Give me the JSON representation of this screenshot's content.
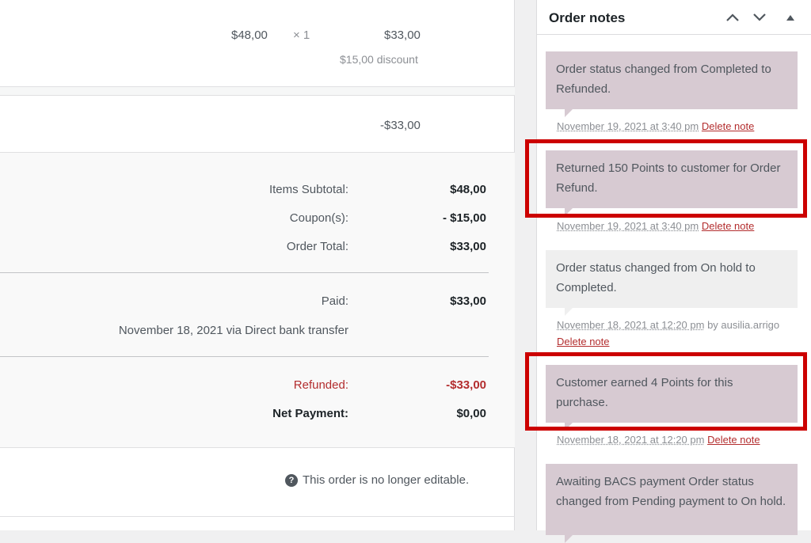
{
  "line_item": {
    "cost": "$48,00",
    "qty": "× 1",
    "total": "$33,00",
    "discount": "$15,00 discount"
  },
  "refund_line": {
    "amount": "-$33,00"
  },
  "totals": {
    "items_subtotal_label": "Items Subtotal:",
    "items_subtotal_value": "$48,00",
    "coupons_label": "Coupon(s):",
    "coupons_value": "- $15,00",
    "order_total_label": "Order Total:",
    "order_total_value": "$33,00"
  },
  "payment": {
    "paid_label": "Paid:",
    "paid_value": "$33,00",
    "paid_detail": "November 18, 2021 via Direct bank transfer"
  },
  "refund": {
    "refunded_label": "Refunded:",
    "refunded_value": "-$33,00",
    "net_label": "Net Payment:",
    "net_value": "$0,00"
  },
  "footer": {
    "not_editable": "This order is no longer editable."
  },
  "notes_panel": {
    "title": "Order notes",
    "notes": [
      {
        "text": "Order status changed from Completed to Refunded.",
        "timestamp": "November 19, 2021 at 3:40 pm",
        "author": "",
        "delete": "Delete note"
      },
      {
        "text": "Returned 150 Points to customer for Order Refund.",
        "timestamp": "November 19, 2021 at 3:40 pm",
        "author": "",
        "delete": "Delete note"
      },
      {
        "text": "Order status changed from On hold to Completed.",
        "timestamp": "November 18, 2021 at 12:20 pm",
        "author": "by ausilia.arrigo",
        "delete": "Delete note"
      },
      {
        "text": "Customer earned 4 Points for this purchase.",
        "timestamp": "November 18, 2021 at 12:20 pm",
        "author": "",
        "delete": "Delete note"
      },
      {
        "text": "Awaiting BACS payment Order status changed from Pending payment to On hold.",
        "timestamp": "",
        "author": "",
        "delete": ""
      }
    ]
  },
  "colors": {
    "note_customer": "#d7cad2",
    "note_system": "#efefef",
    "delete_link": "#b32d2e",
    "highlight": "#cc0000"
  },
  "icons": [
    "chevron-up-icon",
    "chevron-down-icon",
    "toggle-arrow-icon",
    "help-icon"
  ]
}
